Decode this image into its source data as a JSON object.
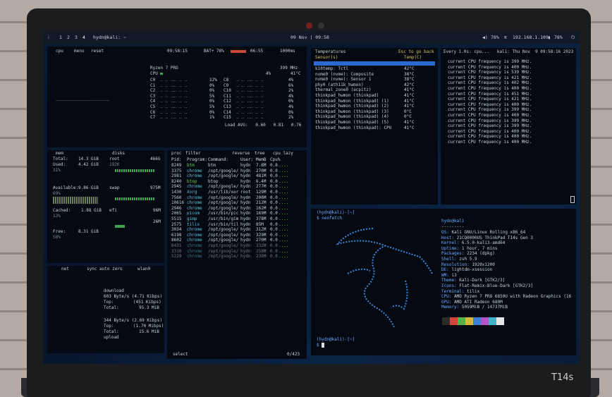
{
  "topbar": {
    "workspaces": [
      "1",
      "2",
      "3",
      "4"
    ],
    "window_title": "hydn@kali: ~",
    "datetime": "09 Nov | 09:58",
    "cpu": "78%",
    "ip": "192.168.1.109",
    "battery": "78%"
  },
  "btop": {
    "header": {
      "tabs": [
        "cpu",
        "menu",
        "reset"
      ],
      "time": "09:58:15",
      "battery": "BAT+ 78%",
      "bat_time": "06:55",
      "interval": "1000ms"
    },
    "cpu_model": "Ryzen 7 PRO",
    "cpu_freq": "399 MHz",
    "cpu_total": "4%",
    "cpu_temp": "41°C",
    "cores": [
      {
        "l": "C0",
        "p": "12%",
        "r": "C8",
        "rp": "4%"
      },
      {
        "l": "C1",
        "p": "0%",
        "r": "C9",
        "rp": "6%"
      },
      {
        "l": "C2",
        "p": "0%",
        "r": "C10",
        "rp": "2%"
      },
      {
        "l": "C3",
        "p": "5%",
        "r": "C11",
        "rp": "4%"
      },
      {
        "l": "C4",
        "p": "0%",
        "r": "C12",
        "rp": "0%"
      },
      {
        "l": "C5",
        "p": "5%",
        "r": "C13",
        "rp": "4%"
      },
      {
        "l": "C6",
        "p": "0%",
        "r": "C14",
        "rp": "0%"
      },
      {
        "l": "C7",
        "p": "1%",
        "r": "C15",
        "rp": "2%"
      }
    ],
    "load_avg": "Load AVG:   0.60   0.81   0.76",
    "mem": {
      "title": "mem",
      "total": "14.3 GiB",
      "used": "4.42 GiB",
      "used_pct": "31%",
      "available": "9.86 GiB",
      "avail_pct": "69%",
      "cached": "1.88 GiB",
      "cached_pct": "13%",
      "free": "8.31 GiB",
      "free_pct": "58%"
    },
    "disks": {
      "title": "disks",
      "root": "root",
      "root_size": "466G",
      "root_used": "192K",
      "swap": "swap",
      "swap_size": "975M",
      "efi": "efi",
      "efi_size": "96M",
      "efi_used": "26M"
    },
    "proc_header": {
      "title": "proc",
      "filter": "filter",
      "reverse": "reverse",
      "tree": "tree",
      "sort": "cpu lazy"
    },
    "proc_cols": [
      "Pid:",
      "Program:",
      "Command:",
      "User:",
      "MemB",
      "Cpu%"
    ],
    "procs": [
      [
        "8249",
        "btm",
        "btm",
        "hydn",
        "7.8M",
        "0.8"
      ],
      [
        "3375",
        "chrome",
        "/opt/google/",
        "hydn",
        "270M",
        "0.0"
      ],
      [
        "2981",
        "chrome",
        "/opt/google/",
        "hydn",
        "481M",
        "0.0"
      ],
      [
        "8240",
        "btop",
        "btop",
        "hydn",
        "6.4M",
        "0.0"
      ],
      [
        "2945",
        "chrome",
        "/opt/google/",
        "hydn",
        "277M",
        "0.0"
      ],
      [
        "1430",
        "Xorg",
        "/usr/lib/xor",
        "root",
        "129M",
        "0.0"
      ],
      [
        "7560",
        "chrome",
        "/opt/google/",
        "hydn",
        "200M",
        "0.0"
      ],
      [
        "10616",
        "chrome",
        "/opt/google/",
        "hydn",
        "212M",
        "0.0"
      ],
      [
        "2946",
        "chrome",
        "/opt/google/",
        "hydn",
        "162M",
        "0.0"
      ],
      [
        "2065",
        "picom",
        "/usr/bin/pic",
        "hydn",
        "169M",
        "0.0"
      ],
      [
        "5515",
        "gimp",
        "/usr/bin/gim",
        "hydn",
        "378M",
        "0.0"
      ],
      [
        "2575",
        "tilix",
        "/usr/bin/til",
        "hydn",
        "85M",
        "0.0"
      ],
      [
        "3034",
        "chrome",
        "/opt/google/",
        "hydn",
        "312M",
        "0.0"
      ],
      [
        "6198",
        "chrome",
        "/opt/google/",
        "hydn",
        "329M",
        "0.0"
      ],
      [
        "8602",
        "chrome",
        "/opt/google/",
        "hydn",
        "270M",
        "0.0"
      ],
      [
        "8431",
        "chrome",
        "/opt/google/",
        "hydn",
        "332M",
        "0.0"
      ],
      [
        "3310",
        "chrome",
        "/opt/google/",
        "hydn",
        "258M",
        "0.0"
      ],
      [
        "5228",
        "chrome",
        "/opt/google/",
        "hydn",
        "239M",
        "0.0"
      ]
    ],
    "proc_footer": {
      "select": "select",
      "count": "0/423"
    },
    "net": {
      "title": "net",
      "download": "download",
      "dl_rate": "603 Byte/s (4.71 Kibps)",
      "dl_top": "(451 Kibps)",
      "dl_total": "95.3 MiB",
      "upload": "upload",
      "ul_rate": "344 Byte/s (2.69 Kibps)",
      "ul_top": "(1.70 Mibps)",
      "ul_total": "15.6 MiB",
      "iface": "wlan0"
    }
  },
  "temps": {
    "title": "Temperatures",
    "subtitle": "Esc to go back",
    "col1": "Sensor(s)",
    "col2": "Temp(C)",
    "rows": [
      [
        "k10temp: Tctl",
        "42°C"
      ],
      [
        "nvme0 (nvme): Composite",
        "38°C"
      ],
      [
        "nvme0 (nvme): Sensor 1",
        "38°C"
      ],
      [
        "phy0 (ath11k_hwmon)",
        "42°C"
      ],
      [
        "thermal_zone0 (acpitz)",
        "41°C"
      ],
      [
        "thinkpad_hwmon (thinkpad)",
        "41°C"
      ],
      [
        "thinkpad_hwmon (thinkpad) (1)",
        "41°C"
      ],
      [
        "thinkpad_hwmon (thinkpad) (2)",
        "41°C"
      ],
      [
        "thinkpad_hwmon (thinkpad) (3)",
        "0°C"
      ],
      [
        "thinkpad_hwmon (thinkpad) (4)",
        "0°C"
      ],
      [
        "thinkpad_hwmon (thinkpad) (5)",
        "41°C"
      ],
      [
        "thinkpad_hwmon (thinkpad): CPU",
        "41°C"
      ]
    ]
  },
  "watch": {
    "header": "Every 1.0s: cpu...   kali: Thu Nov  9 09:58:16 2023",
    "lines": [
      "current CPU frequency is 399 MHz.",
      "current CPU frequency is 400 MHz.",
      "current CPU frequency is 539 MHz.",
      "current CPU frequency is 421 MHz.",
      "current CPU frequency is 402 MHz.",
      "current CPU frequency is 400 MHz.",
      "current CPU frequency is 451 MHz.",
      "current CPU frequency is 421 MHz.",
      "current CPU frequency is 400 MHz.",
      "current CPU frequency is 399 MHz.",
      "current CPU frequency is 400 MHz.",
      "current CPU frequency is 399 MHz.",
      "current CPU frequency is 399 MHz.",
      "current CPU frequency is 400 MHz.",
      "current CPU frequency is 400 MHz.",
      "current CPU frequency is 400 MHz."
    ]
  },
  "neofetch": {
    "prompt": "(hydn@kali)-[~]",
    "cmd": "$ neofetch",
    "userhost": "hydn@kali",
    "sep": "---------",
    "info": [
      [
        "OS:",
        "Kali GNU/Linux Rolling x86_64"
      ],
      [
        "Host:",
        "21CQ0000US ThinkPad T14s Gen 3"
      ],
      [
        "Kernel:",
        "6.5.0-kali3-amd64"
      ],
      [
        "Uptime:",
        "1 hour, 7 mins"
      ],
      [
        "Packages:",
        "2234 (dpkg)"
      ],
      [
        "Shell:",
        "zsh 5.9"
      ],
      [
        "Resolution:",
        "1920x1200"
      ],
      [
        "DE:",
        "lightdm-xsession"
      ],
      [
        "WM:",
        "i3"
      ],
      [
        "Theme:",
        "Kali-Dark [GTK2/3]"
      ],
      [
        "Icons:",
        "Flat-Remix-Blue-Dark [GTK2/3]"
      ],
      [
        "Terminal:",
        "tilix"
      ],
      [
        "CPU:",
        "AMD Ryzen 7 PRO 6850U with Radeon Graphics (16"
      ],
      [
        "GPU:",
        "AMD ATI Radeon 680M"
      ],
      [
        "Memory:",
        "5059MiB / 14737MiB"
      ]
    ],
    "prompt2": "(hydn@kali)-[~]",
    "cmd2": "$",
    "palette": [
      "#2b2b2b",
      "#d3453b",
      "#4fb64a",
      "#d9b53a",
      "#3c7fd6",
      "#b453c8",
      "#3fb3c8",
      "#e6e6e6"
    ]
  },
  "model": "T14s"
}
